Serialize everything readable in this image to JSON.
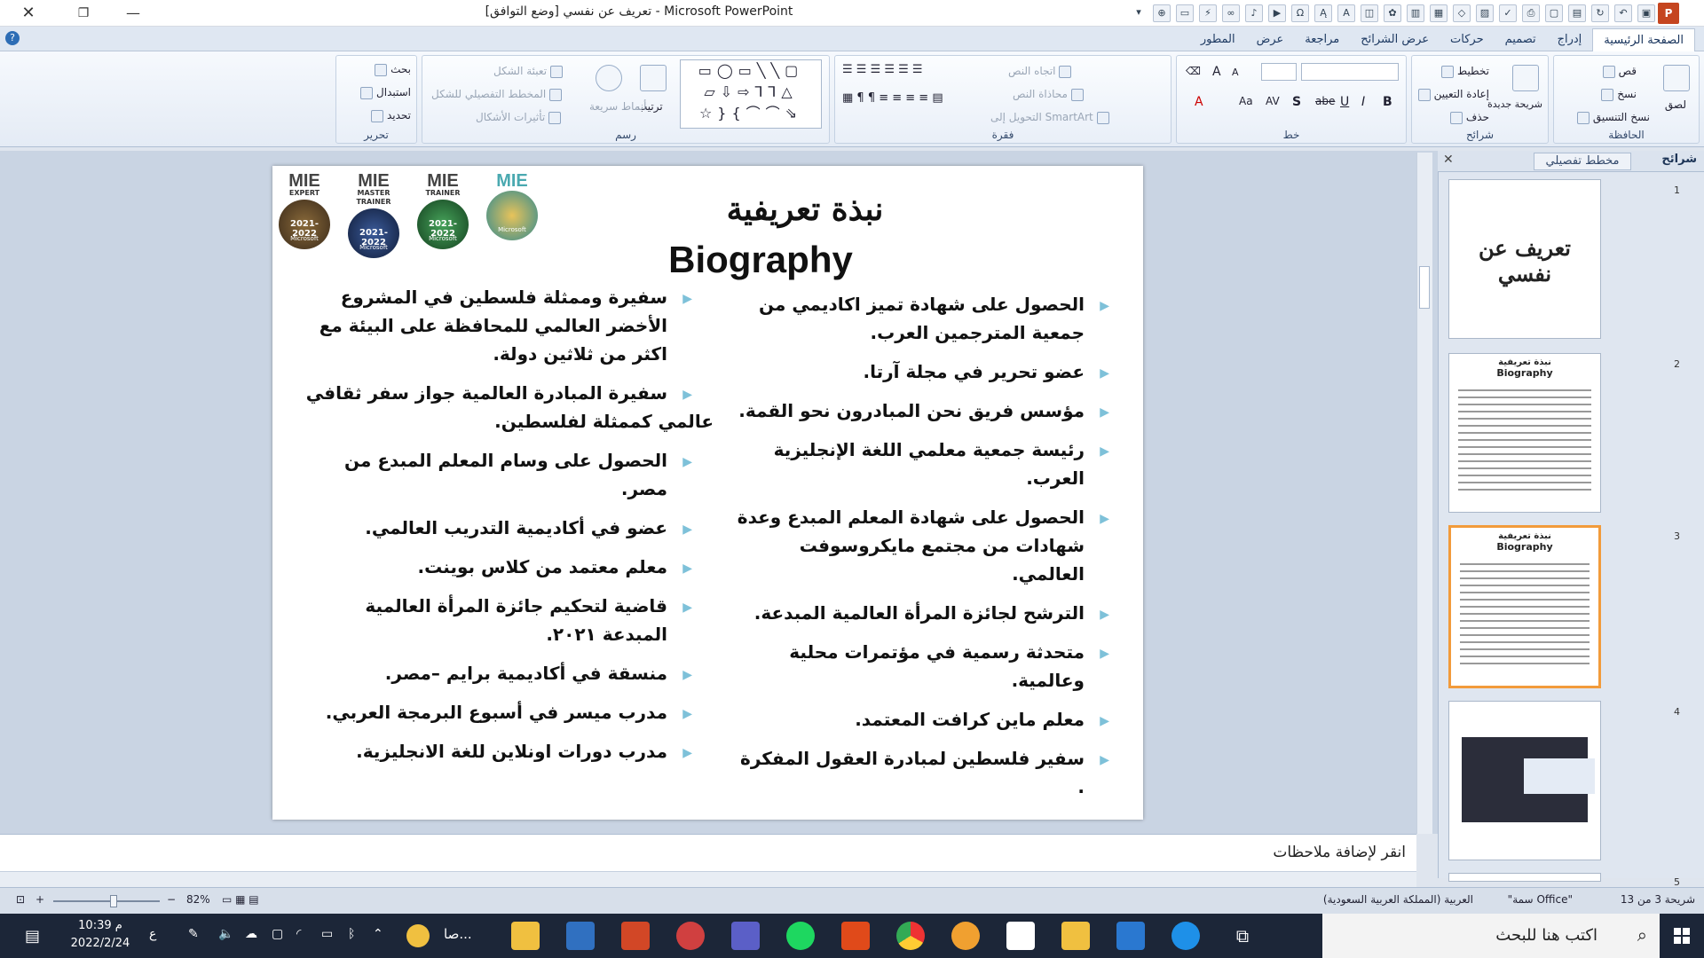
{
  "window": {
    "title": "تعريف عن نفسي [وضع التوافق] - Microsoft PowerPoint",
    "close": "✕",
    "maximize": "❐",
    "minimize": "—"
  },
  "qat_icons": [
    "save-icon",
    "undo-icon",
    "redo-icon",
    "open-icon",
    "new-icon",
    "print-icon",
    "spell-icon",
    "picture-icon",
    "shapes-icon",
    "table-icon",
    "chart-icon",
    "clipart-icon",
    "smartart-icon",
    "textbox-icon",
    "wordart-icon",
    "symbol-icon",
    "media-icon",
    "sound-icon",
    "hyperlink-icon",
    "action-icon",
    "slideshow-icon",
    "zoom-icon",
    "more-icon"
  ],
  "tabs": [
    {
      "label": "الصفحة الرئيسية",
      "active": true
    },
    {
      "label": "إدراج"
    },
    {
      "label": "تصميم"
    },
    {
      "label": "حركات"
    },
    {
      "label": "عرض الشرائح"
    },
    {
      "label": "مراجعة"
    },
    {
      "label": "عرض"
    },
    {
      "label": "المطور"
    }
  ],
  "ribbon": {
    "clipboard": {
      "label": "الحافظة",
      "paste": "لصق",
      "cut": "قص",
      "copy": "نسخ",
      "format_painter": "نسخ التنسيق"
    },
    "slides": {
      "label": "شرائح",
      "new_slide": "شريحة جديدة",
      "layout": "تخطيط",
      "reset": "إعادة التعيين",
      "delete": "حذف"
    },
    "font": {
      "label": "خط"
    },
    "paragraph": {
      "label": "فقرة",
      "text_direction": "اتجاه النص",
      "align_text": "محاذاة النص",
      "smartart": "التحويل إلى SmartArt"
    },
    "drawing": {
      "label": "رسم",
      "arrange": "ترتيب",
      "quick_styles": "أنماط سريعة",
      "shape_fill": "تعبئة الشكل",
      "shape_outline": "المخطط التفصيلي للشكل",
      "shape_effects": "تأثيرات الأشكال"
    },
    "editing": {
      "label": "تحرير",
      "find": "بحث",
      "replace": "استبدال",
      "select": "تحديد"
    }
  },
  "panel": {
    "tab_slides": "شرائح",
    "tab_outline": "مخطط تفصيلي",
    "close": "✕",
    "thumbs": [
      {
        "num": "1",
        "title": "تعريف عن نفسي"
      },
      {
        "num": "2",
        "title": "نبذة تعريفية",
        "subtitle": "Biography"
      },
      {
        "num": "3",
        "title": "نبذة تعريفية",
        "subtitle": "Biography"
      },
      {
        "num": "4"
      },
      {
        "num": "5"
      }
    ]
  },
  "slide": {
    "title_ar": "نبذة تعريفية",
    "title_en": "Biography",
    "badges": [
      {
        "top": "MIE",
        "sub": "EXPERT",
        "year": "2021-2022",
        "ms": "Microsoft",
        "color": "#6b4a2c"
      },
      {
        "top": "MIE",
        "sub": "MASTER TRAINER",
        "year": "2021-2022",
        "ms": "Microsoft",
        "color": "#1f3a6d"
      },
      {
        "top": "MIE",
        "sub": "TRAINER",
        "year": "2021-2022",
        "ms": "Microsoft",
        "color": "#2d7a3a"
      },
      {
        "top": "MIE",
        "sub": "",
        "year": "",
        "ms": "Microsoft",
        "color": "#3aa0a8"
      }
    ],
    "right_col": [
      "الحصول على شهادة تميز اكاديمي من جمعية المترجمين العرب.",
      "عضو تحرير في مجلة آرتا.",
      "مؤسس فريق نحن المبادرون نحو القمة.",
      "رئيسة جمعية معلمي اللغة الإنجليزية العرب.",
      "الحصول على شهادة المعلم المبدع وعدة شهادات من مجتمع مايكروسوفت العالمي.",
      "الترشح لجائزة المرأة العالمية المبدعة.",
      "متحدثة رسمية في مؤتمرات محلية وعالمية.",
      "معلم ماين كرافت المعتمد.",
      "سفير فلسطين لمبادرة العقول المفكرة ."
    ],
    "left_col": [
      "سفيرة وممثلة فلسطين في المشروع  الأخضر العالمي للمحافظة على البيئة مع اكثر من ثلاثين دولة.",
      "سفيرة المبادرة  العالمية جواز سفر ثقافي",
      "الحصول على وسام المعلم المبدع من مصر.",
      "عضو  في أكاديمية التدريب العالمي.",
      "معلم معتمد من كلاس بوينت.",
      "قاضية لتحكيم جائزة المرأة العالمية المبدعة ٢٠٢١.",
      "منسقة في أكاديمية برايم –مصر.",
      "مدرب ميسر في أسبوع البرمجة العربي.",
      "مدرب دورات اونلاين للغة الانجليزية."
    ],
    "left_col_continuation": "عالمي كممثلة لفلسطين."
  },
  "notes": {
    "placeholder": "انقر لإضافة ملاحظات"
  },
  "status": {
    "slide_info": "شريحة 3 من 13",
    "theme": "\"سمة Office\"",
    "language": "العربية (المملكة العربية السعودية)",
    "zoom": "82%",
    "zoom_minus": "−",
    "zoom_plus": "+"
  },
  "taskbar": {
    "search": "اكتب هنا للبحث",
    "time": "10:39 م",
    "date": "2022/2/24",
    "lang": "ع",
    "app_label": "صا..."
  }
}
